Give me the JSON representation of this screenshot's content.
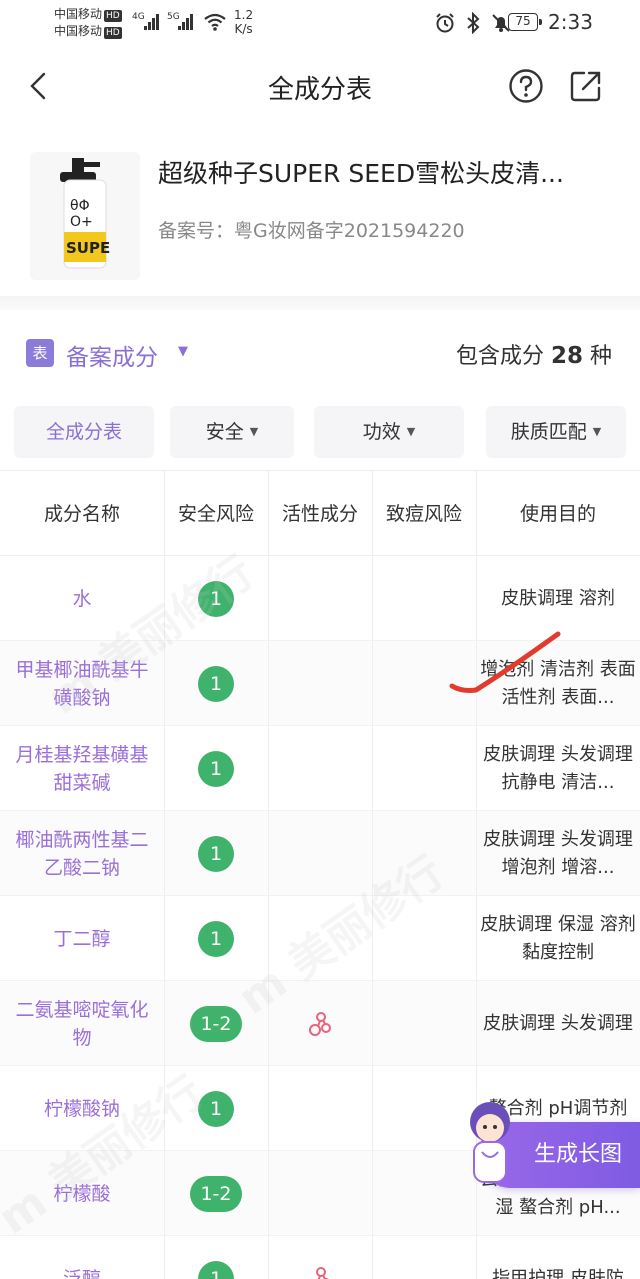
{
  "status": {
    "carrier1": "中国移动",
    "carrier2": "中国移动",
    "hd": "HD",
    "net1": "4G",
    "net2": "5G",
    "speed_value": "1.2",
    "speed_unit": "K/s",
    "battery": "75",
    "time": "2:33"
  },
  "nav": {
    "title": "全成分表"
  },
  "product": {
    "name": "超级种子SUPER SEED雪松头皮清...",
    "reg_label": "备案号：",
    "reg_number": "粤G妆网备字2021594220",
    "logo_text": "SUPE"
  },
  "section": {
    "icon_text": "表",
    "title": "备案成分",
    "count_prefix": "包含成分",
    "count": "28",
    "count_suffix": "种"
  },
  "filters": [
    {
      "label": "全成分表",
      "active": true
    },
    {
      "label": "安全",
      "active": false
    },
    {
      "label": "功效",
      "active": false
    },
    {
      "label": "肤质匹配",
      "active": false
    }
  ],
  "table": {
    "headers": [
      "成分名称",
      "安全风险",
      "活性成分",
      "致痘风险",
      "使用目的"
    ],
    "rows": [
      {
        "name": "水",
        "risk": "1",
        "active": false,
        "purpose": "皮肤调理 溶剂"
      },
      {
        "name": "甲基椰油酰基牛磺酸钠",
        "risk": "1",
        "active": false,
        "purpose": "增泡剂 清洁剂 表面活性剂 表面..."
      },
      {
        "name": "月桂基羟基磺基甜菜碱",
        "risk": "1",
        "active": false,
        "purpose": "皮肤调理 头发调理 抗静电 清洁..."
      },
      {
        "name": "椰油酰两性基二乙酸二钠",
        "risk": "1",
        "active": false,
        "purpose": "皮肤调理 头发调理 增泡剂 增溶..."
      },
      {
        "name": "丁二醇",
        "risk": "1",
        "active": false,
        "purpose": "皮肤调理 保湿 溶剂 黏度控制"
      },
      {
        "name": "二氨基嘧啶氧化物",
        "risk": "1-2",
        "active": true,
        "purpose": "皮肤调理 头发调理"
      },
      {
        "name": "柠檬酸钠",
        "risk": "1",
        "active": false,
        "purpose": "螯合剂 pH调节剂"
      },
      {
        "name": "柠檬酸",
        "risk": "1-2",
        "active": false,
        "purpose": "去角质 香料成分 保湿 螯合剂 pH..."
      },
      {
        "name": "泛醇",
        "risk": "1",
        "active": true,
        "purpose": "指甲护理 皮肤防"
      }
    ]
  },
  "floating": {
    "generate_label": "生成长图"
  },
  "colors": {
    "accent": "#8c6fd6",
    "risk_green": "#3fb36b"
  }
}
